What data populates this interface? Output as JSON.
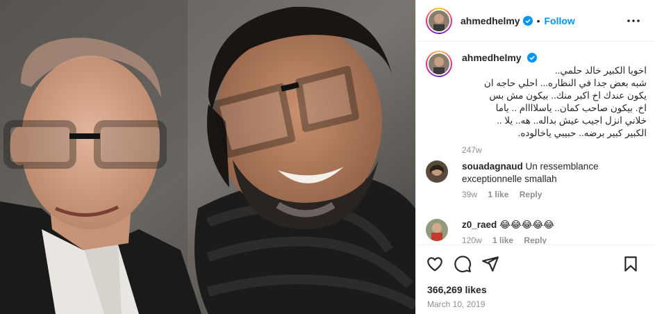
{
  "post": {
    "author": {
      "username": "ahmedhelmy",
      "verified": true,
      "follow_label": "Follow",
      "separator": "•"
    },
    "caption": {
      "username": "ahmedhelmy",
      "text": "اخويا الكبير خالد حلمي.. \nشبه بعض جدا في النظاره... احلي حاجه ان\nيكون عندك اخ اكبر منك.. بيكون مش بس\nاخ. بيكون صاحب كمان.. ياسلاااام .. ياما\nخلاني انزل اجيب عيش بداله.. هه.. يلا ..\nالكبير كبير برضه.. حبيبي ياخالوده.",
      "time": "247w"
    },
    "comments": [
      {
        "username": "souadagnaud",
        "text": "Un ressemblance exceptionnelle smallah",
        "time": "39w",
        "likes": "1 like",
        "reply": "Reply"
      },
      {
        "username": "z0_raed",
        "text": "😂😂😂😂😂",
        "time": "120w",
        "likes": "1 like",
        "reply": "Reply"
      }
    ],
    "likes": "366,269 likes",
    "date": "March 10, 2019",
    "icons": [
      "like-icon",
      "comment-icon",
      "share-icon",
      "save-icon",
      "more-options-icon",
      "verified-icon"
    ],
    "colors": {
      "follow": "#0095f6",
      "verified": "#0095f6",
      "muted": "#8e8e8e",
      "text": "#262626",
      "border": "#efefef"
    }
  }
}
